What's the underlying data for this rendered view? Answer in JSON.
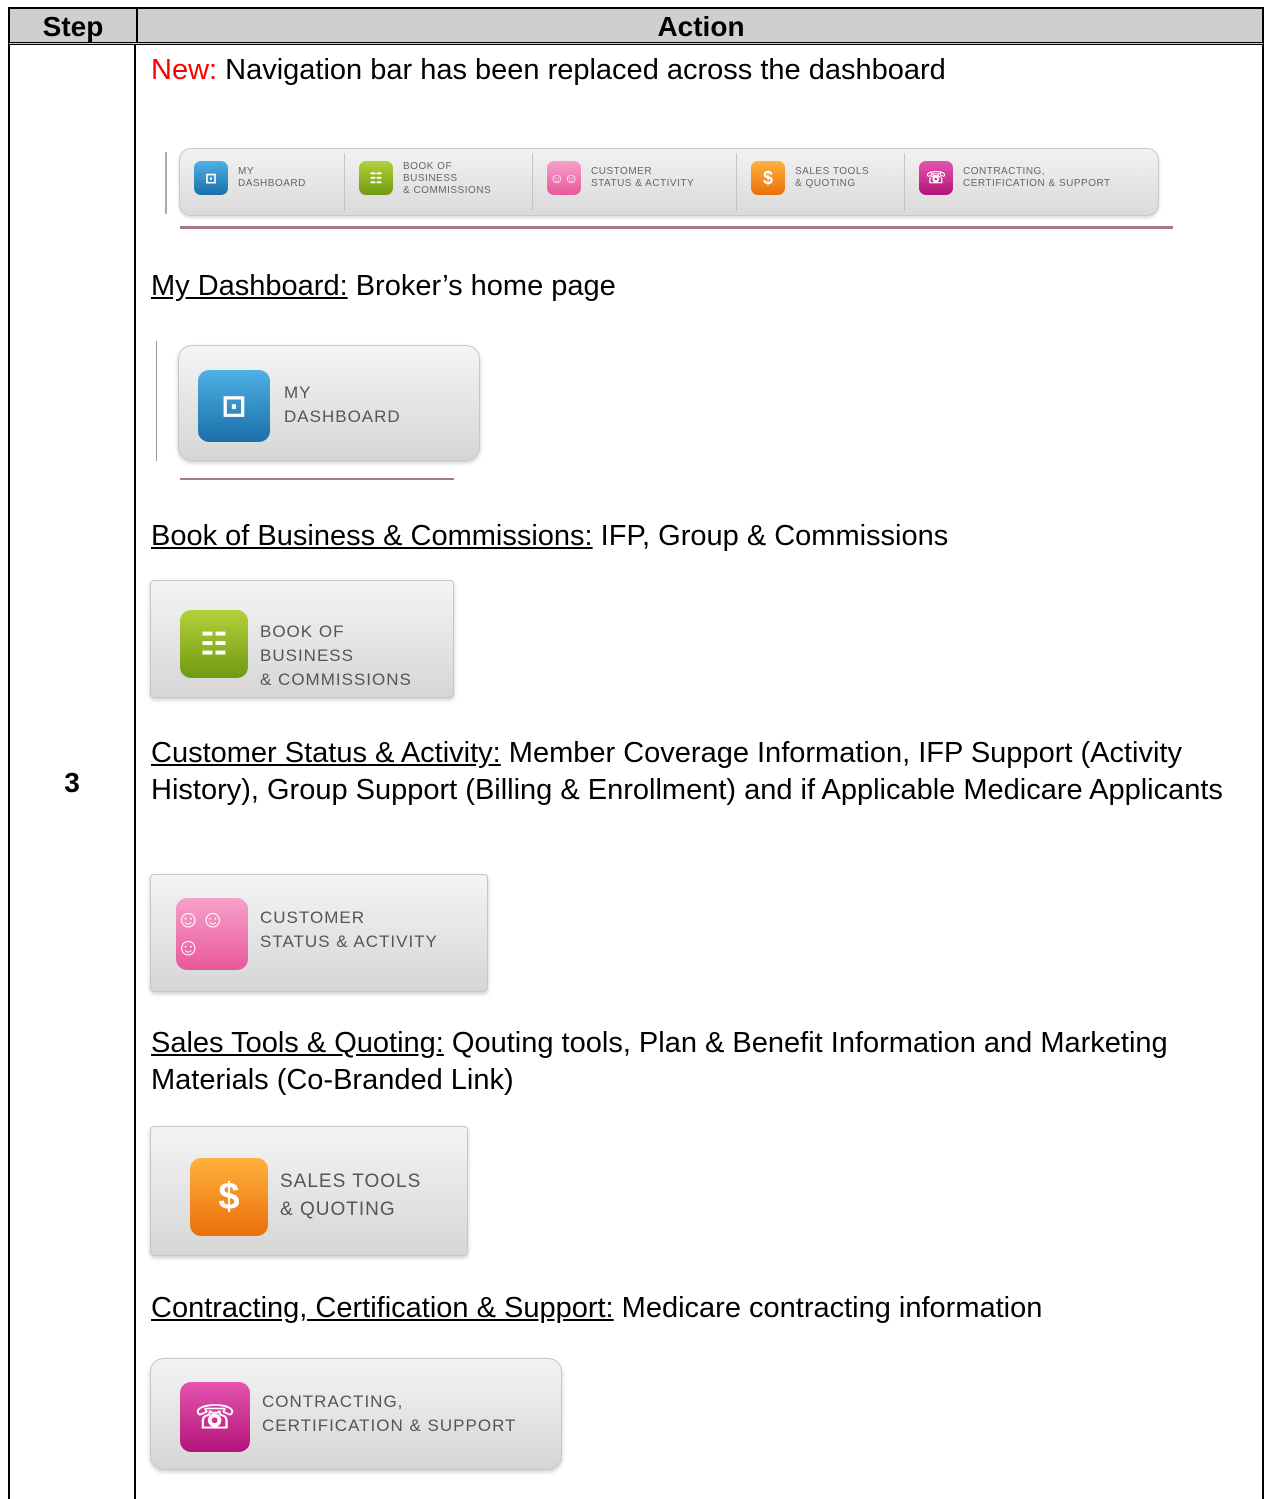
{
  "table": {
    "header_step": "Step",
    "header_action": "Action",
    "step_number": "3"
  },
  "intro": {
    "prefix": "New:",
    "text": " Navigation bar has been replaced across the dashboard"
  },
  "nav": {
    "items": [
      {
        "line1": "MY",
        "line2": "DASHBOARD",
        "line3": "",
        "icon": "briefcase-icon"
      },
      {
        "line1": "BOOK OF",
        "line2": "BUSINESS",
        "line3": "& COMMISSIONS",
        "icon": "id-card-icon"
      },
      {
        "line1": "CUSTOMER",
        "line2": "STATUS & ACTIVITY",
        "line3": "",
        "icon": "people-icon"
      },
      {
        "line1": "SALES TOOLS",
        "line2": "& QUOTING",
        "line3": "",
        "icon": "dollar-monitor-icon"
      },
      {
        "line1": "CONTRACTING,",
        "line2": "CERTIFICATION & SUPPORT",
        "line3": "",
        "icon": "phone-book-icon"
      }
    ]
  },
  "sections": {
    "dashboard": {
      "title": "My Dashboard:",
      "desc": " Broker’s home page"
    },
    "book": {
      "title": "Book of Business & Commissions:",
      "desc": " IFP, Group & Commissions"
    },
    "customer": {
      "title": "Customer Status & Activity:",
      "desc": "  Member Coverage Information, IFP Support (Activity History), Group Support (Billing & Enrollment) and if Applicable Medicare Applicants"
    },
    "sales": {
      "title": "Sales Tools & Quoting:",
      "desc": "  Qouting tools, Plan & Benefit Information and Marketing Materials (Co-Branded Link)"
    },
    "contracting": {
      "title": "Contracting, Certification & Support:",
      "desc": " Medicare contracting information"
    }
  },
  "colors": {
    "blue": "#1a6fa8",
    "green": "#6f9a12",
    "pink": "#e8579c",
    "orange": "#ea6f0a",
    "magenta": "#b31479",
    "red": "#ff0000"
  }
}
